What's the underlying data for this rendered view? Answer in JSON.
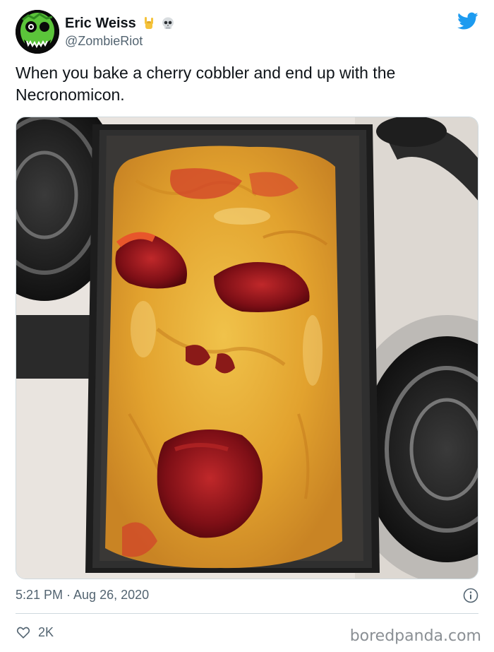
{
  "tweet": {
    "author_name": "Eric Weiss",
    "author_handle": "@ZombieRiot",
    "text": "When you bake a cherry cobbler and end up with the Necronomicon.",
    "timestamp": "5:21 PM · Aug 26, 2020",
    "like_count": "2K"
  },
  "icons": {
    "avatar": "zombie-avatar",
    "badge_1": "rock-hand-icon",
    "badge_2": "skull-icon",
    "brand": "twitter-bird-icon",
    "info": "info-icon",
    "like": "heart-icon"
  },
  "watermark": "boredpanda.com",
  "colors": {
    "brand_blue": "#1d9bf0",
    "secondary_text": "#536471",
    "border": "#cfd9de"
  }
}
